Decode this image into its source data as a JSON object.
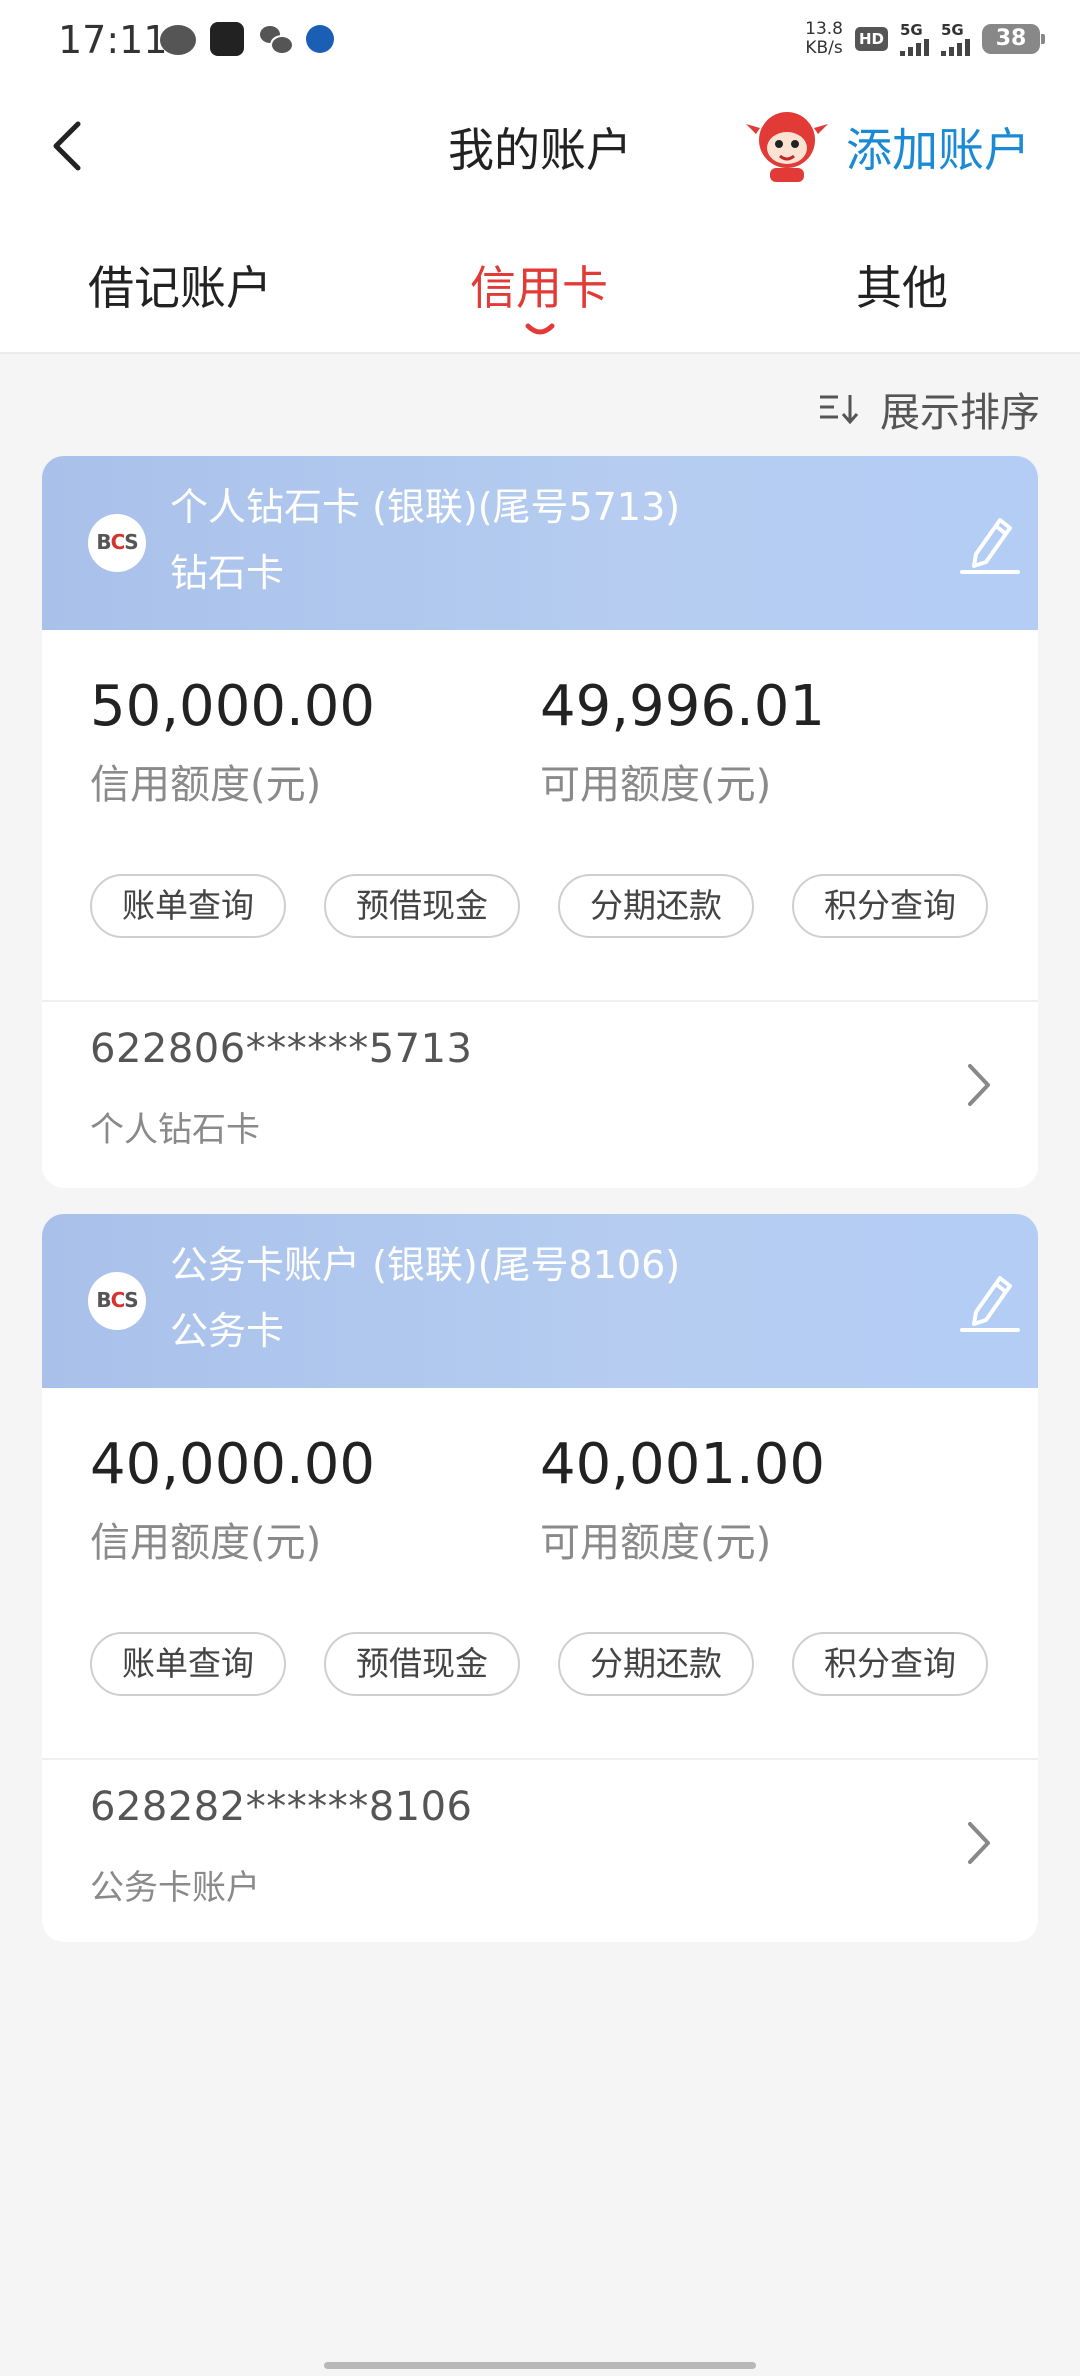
{
  "status_bar": {
    "time": "17:11",
    "speed_value": "13.8",
    "speed_unit": "KB/s",
    "hd_label": "HD",
    "signal_1": "5G",
    "signal_2": "5G",
    "battery": "38"
  },
  "header": {
    "title": "我的账户",
    "add_account": "添加账户"
  },
  "tabs": [
    {
      "label": "借记账户",
      "active": false
    },
    {
      "label": "信用卡",
      "active": true
    },
    {
      "label": "其他",
      "active": false
    }
  ],
  "sort": {
    "label": "展示排序"
  },
  "cards": [
    {
      "title": "个人钻石卡 (银联)(尾号5713)",
      "subtitle": "钻石卡",
      "credit_limit": "50,000.00",
      "credit_limit_label": "信用额度(元)",
      "available_limit": "49,996.01",
      "available_limit_label": "可用额度(元)",
      "actions": [
        "账单查询",
        "预借现金",
        "分期还款",
        "积分查询"
      ],
      "card_number": "622806******5713",
      "card_name": "个人钻石卡"
    },
    {
      "title": "公务卡账户 (银联)(尾号8106)",
      "subtitle": "公务卡",
      "credit_limit": "40,000.00",
      "credit_limit_label": "信用额度(元)",
      "available_limit": "40,001.00",
      "available_limit_label": "可用额度(元)",
      "actions": [
        "账单查询",
        "预借现金",
        "分期还款",
        "积分查询"
      ],
      "card_number": "628282******8106",
      "card_name": "公务卡账户"
    }
  ],
  "bank_logo_text": "BCS",
  "colors": {
    "accent_red": "#e23a36",
    "link_blue": "#1a8ad4",
    "card_header": "#b0c8f0"
  },
  "icons": [
    "back-icon",
    "mascot-icon",
    "sort-icon",
    "edit-icon",
    "chevron-right-icon",
    "bank-logo-icon"
  ]
}
